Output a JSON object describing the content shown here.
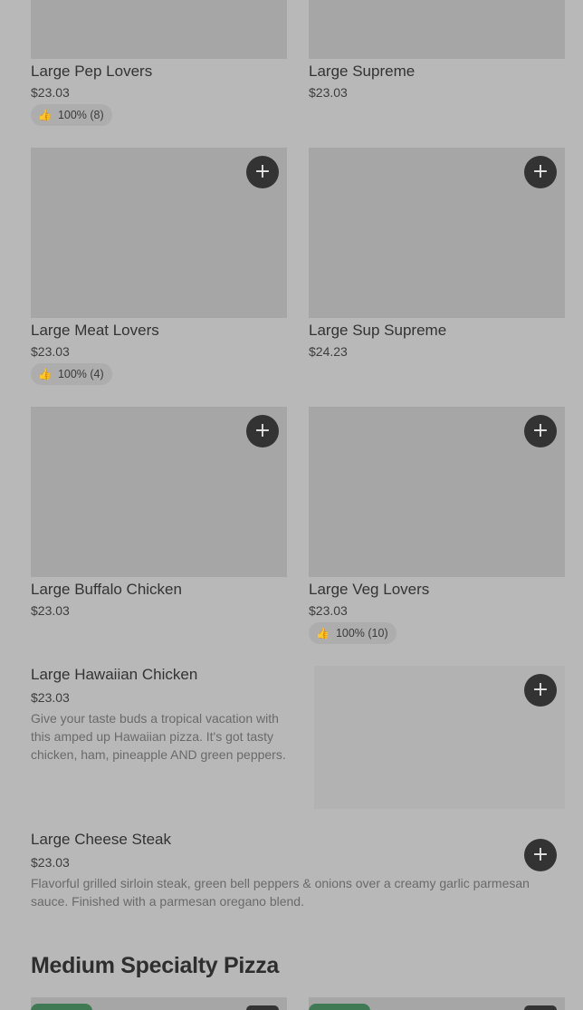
{
  "icons": {
    "add": "plus-icon",
    "rating": "thumbs-up-icon"
  },
  "colors": {
    "page_bg": "#b8b8b8",
    "image_placeholder": "#a6a6a6",
    "add_button": "#333333",
    "badge_green": "#3f7a55"
  },
  "items": [
    {
      "name": "Large Pep Lovers",
      "price": "$23.03",
      "rating": "100% (8)"
    },
    {
      "name": "Large Supreme",
      "price": "$23.03"
    },
    {
      "name": "Large Meat Lovers",
      "price": "$23.03",
      "rating": "100% (4)"
    },
    {
      "name": "Large Sup Supreme",
      "price": "$24.23"
    },
    {
      "name": "Large Buffalo Chicken",
      "price": "$23.03"
    },
    {
      "name": "Large Veg Lovers",
      "price": "$23.03",
      "rating": "100% (10)"
    },
    {
      "name": "Large Hawaiian Chicken",
      "price": "$23.03",
      "description": "Give your taste buds a tropical vacation with this amped up Hawaiian pizza. It's got tasty chicken, ham, pineapple AND green peppers."
    },
    {
      "name": "Large Cheese Steak",
      "price": "$23.03",
      "description": "Flavorful grilled sirloin steak, green bell peppers & onions over a creamy garlic parmesan sauce. Finished with a parmesan oregano blend."
    }
  ],
  "sections": {
    "medium_title": "Medium Specialty Pizza"
  },
  "add_label": "+",
  "thumb_glyph": "👍"
}
